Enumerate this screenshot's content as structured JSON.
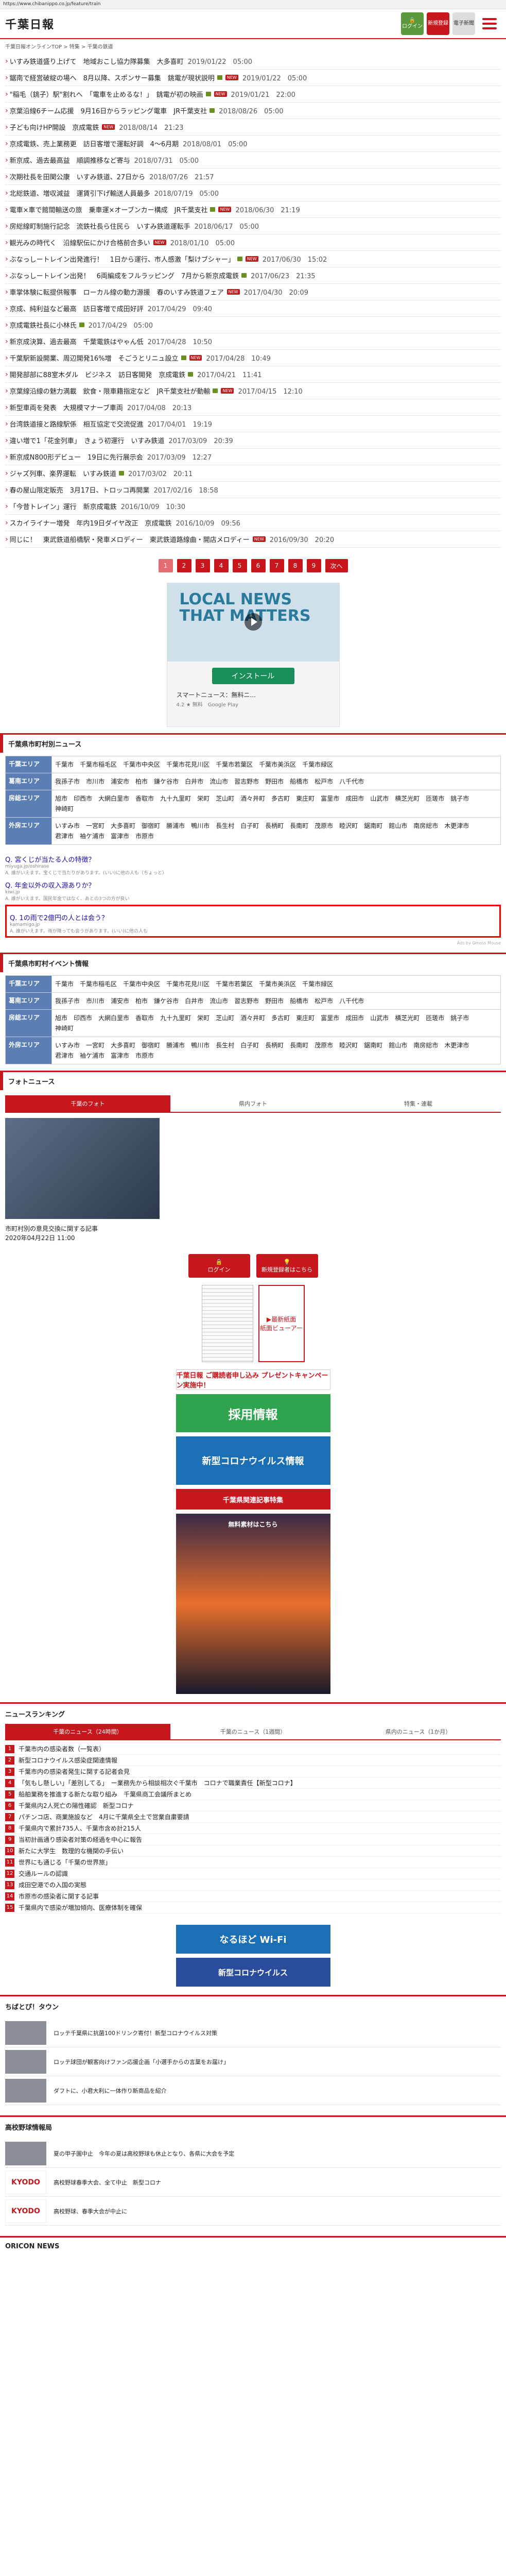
{
  "url": "https://www.chibanippo.co.jp/feature/train",
  "header": {
    "logo": "千葉日報",
    "btn_login": "ログイン",
    "btn_register": "新規登録",
    "btn_epaper": "電子新聞"
  },
  "breadcrumb": "千葉日報オンラインTOP > 特集 > 千葉の鉄道",
  "news": [
    {
      "title": "いすみ鉄道盛り上げて　地域おこし協力隊募集　大多喜町",
      "date": "2019/01/22　05:00",
      "cam": false,
      "badge": false
    },
    {
      "title": "鋸南で経営破綻の場へ　8月以降、スポンサー募集　銚電が現状説明",
      "date": "2019/01/22　05:00",
      "cam": true,
      "badge": true
    },
    {
      "title": "\"稲毛（銚子）駅\"割れへ　「電車を止めるな！」　銚電が初の映画",
      "date": "2019/01/21　22:00",
      "cam": true,
      "badge": true
    },
    {
      "title": "京葉沿線6チーム応援　9月16日からラッピング電車　JR千葉支社",
      "date": "2018/08/26　05:00",
      "cam": true,
      "badge": false
    },
    {
      "title": "子ども向けHP開設　京成電鉄",
      "date": "2018/08/14　21:23",
      "cam": false,
      "badge": true
    },
    {
      "title": "京成電鉄、売上業務更　訪日客増で運転好調　4〜6月期",
      "date": "2018/08/01　05:00",
      "cam": false,
      "badge": false
    },
    {
      "title": "新京成、過去最高益　順調推移など寄与",
      "date": "2018/07/31　05:00",
      "cam": false,
      "badge": false
    },
    {
      "title": "次期社長を田関公康　いすみ鉄道、27日から",
      "date": "2018/07/26　21:57",
      "cam": false,
      "badge": false
    },
    {
      "title": "北総鉄道、増収減益　運賃引下げ輸送人員最多",
      "date": "2018/07/19　05:00",
      "cam": false,
      "badge": false
    },
    {
      "title": "電車×車で館間輸送の旅　乗車運×オーブンカー構成　JR千葉支社",
      "date": "2018/06/30　21:19",
      "cam": true,
      "badge": true
    },
    {
      "title": "房総線町制施行記念　流鉄社長ら住民ら　いすみ鉄道運転手",
      "date": "2018/06/17　05:00",
      "cam": false,
      "badge": false
    },
    {
      "title": "観光みの時代く　沿線駅伝にかけ合格前合多い",
      "date": "2018/01/10　05:00",
      "cam": false,
      "badge": true
    },
    {
      "title": "ぶなっしートレイン出発進行！　1日から運行、市人感激「梨けブシャー」",
      "date": "2017/06/30　15:02",
      "cam": true,
      "badge": true
    },
    {
      "title": "ぶなっしートレイン出発！　6両編成をフルラッピング　7月から新京成電鉄",
      "date": "2017/06/23　21:35",
      "cam": true,
      "badge": false
    },
    {
      "title": "車掌体験に転提供報事　ローカル線の動力源援　春のいすみ鉄道フェア",
      "date": "2017/04/30　20:09",
      "cam": false,
      "badge": true
    },
    {
      "title": "京成、純利益など最高　訪日客増で成田好評",
      "date": "2017/04/29　09:40",
      "cam": false,
      "badge": false
    },
    {
      "title": "京成電鉄社長に小林氏",
      "date": "2017/04/29　05:00",
      "cam": true,
      "badge": false
    },
    {
      "title": "新京成決算、過去最高　千葉電鉄はやゃん低",
      "date": "2017/04/28　10:50",
      "cam": false,
      "badge": false
    },
    {
      "title": "千葉駅新設開業、周辺開発16%増　そごうとリニュ設立",
      "date": "2017/04/28　10:49",
      "cam": true,
      "badge": true
    },
    {
      "title": "開発部部に88室木ダル　ビジネス　訪日客開発　京成電鉄",
      "date": "2017/04/21　11:41",
      "cam": true,
      "badge": false
    },
    {
      "title": "京葉線沿線の魅力満載　飲食・限車籍指定など　JR千葉支社が動輸",
      "date": "2017/04/15　12:10",
      "cam": true,
      "badge": true
    },
    {
      "title": "新型車両を発表　大規模マナーブ車両",
      "date": "2017/04/08　20:13",
      "cam": false,
      "badge": false
    },
    {
      "title": "台湾鉄道接と路線駅係　相互協定で交流促進",
      "date": "2017/04/01　19:19",
      "cam": false,
      "badge": false
    },
    {
      "title": "違い増で1「花金列車」　きょう初運行　いすみ鉄道",
      "date": "2017/03/09　20:39",
      "cam": false,
      "badge": false
    },
    {
      "title": "新京成N800形デビュー　19日に先行展示会",
      "date": "2017/03/09　12:27",
      "cam": false,
      "badge": false
    },
    {
      "title": "ジャズ列車、楽界運転　いすみ鉄道",
      "date": "2017/03/02　20:11",
      "cam": true,
      "badge": false
    },
    {
      "title": "春の屋山限定販売　3月17日、トロッコ再開業",
      "date": "2017/02/16　18:58",
      "cam": false,
      "badge": false
    },
    {
      "title": "「今昔トレイン」運行　新京成電鉄",
      "date": "2016/10/09　10:30",
      "cam": false,
      "badge": false
    },
    {
      "title": "スカイライナー増発　年内19日ダイヤ改正　京成電鉄",
      "date": "2016/10/09　09:56",
      "cam": false,
      "badge": false
    },
    {
      "title": "同じに！　東武鉄道船橋駅・発車メロディー　東武鉄道路線曲・開店メロディー",
      "date": "2016/09/30　20:20",
      "cam": false,
      "badge": true
    }
  ],
  "pager": {
    "pages": [
      "1",
      "2",
      "3",
      "4",
      "5",
      "6",
      "7",
      "8",
      "9"
    ],
    "current": "1",
    "next": "次へ"
  },
  "ad": {
    "headline": "LOCAL NEWS THAT MATTERS",
    "install": "インストール",
    "app": "スマートニュース：無料ニ...",
    "rating": "4.2 ★ 無料　Google Play"
  },
  "city_section": {
    "title": "千葉県市町村別ニュース",
    "rows": [
      {
        "head": "千葉エリア",
        "items": [
          "千葉市",
          "千葉市稲毛区",
          "千葉市中央区",
          "千葉市花見川区",
          "千葉市若葉区",
          "千葉市美浜区",
          "千葉市緑区"
        ]
      },
      {
        "head": "葛南エリア",
        "items": [
          "我孫子市",
          "市川市",
          "浦安市",
          "柏市",
          "鎌ケ谷市",
          "白井市",
          "流山市",
          "習志野市",
          "野田市",
          "船橋市",
          "松戸市",
          "八千代市"
        ]
      },
      {
        "head": "房総エリア",
        "items": [
          "旭市",
          "印西市",
          "大網白里市",
          "香取市",
          "九十九里町",
          "栄町",
          "芝山町",
          "酒々井町",
          "多古町",
          "東庄町",
          "富里市",
          "成田市",
          "山武市",
          "横芝光町",
          "匝瑳市",
          "銚子市",
          "神崎町"
        ]
      },
      {
        "head": "外房エリア",
        "items": [
          "いすみ市",
          "一宮町",
          "大多喜町",
          "御宿町",
          "勝浦市",
          "鴨川市",
          "長生村",
          "白子町",
          "長柄町",
          "長南町",
          "茂原市",
          "睦沢町",
          "鋸南町",
          "館山市",
          "南房総市",
          "木更津市",
          "君津市",
          "袖ケ浦市",
          "富津市",
          "市原市"
        ]
      }
    ]
  },
  "qa": [
    {
      "q": "Q. 宮くじが当たる人の特徴？",
      "s": "miyuga.jp/oshirase",
      "note": "A. 誰がいえます。宝くじで当たりがあります。(いい)に他の人も（ちょっと）"
    },
    {
      "q": "Q. 年金以外の収入源ありか？",
      "s": "kiwi.jp",
      "note": "A. 誰がいえます。国民年金ではなく、あとの3つの方が良い"
    },
    {
      "q": "Q. 1の雨で2億円の人とは会う？",
      "s": "kamamigo.jp",
      "note": "A. 誰がいえます。雨が降っても会うがあります。(いい)に他の人も"
    }
  ],
  "adby": "Ads by Gmoss Mouse",
  "event_section": {
    "title": "千葉県市町村イベント情報",
    "rows": [
      {
        "head": "千葉エリア",
        "items": [
          "千葉市",
          "千葉市稲毛区",
          "千葉市中央区",
          "千葉市花見川区",
          "千葉市若葉区",
          "千葉市美浜区",
          "千葉市緑区"
        ]
      },
      {
        "head": "葛南エリア",
        "items": [
          "我孫子市",
          "市川市",
          "浦安市",
          "柏市",
          "鎌ケ谷市",
          "白井市",
          "流山市",
          "習志野市",
          "野田市",
          "船橋市",
          "松戸市",
          "八千代市"
        ]
      },
      {
        "head": "房総エリア",
        "items": [
          "旭市",
          "印西市",
          "大網白里市",
          "香取市",
          "九十九里町",
          "栄町",
          "芝山町",
          "酒々井町",
          "多古町",
          "東庄町",
          "富里市",
          "成田市",
          "山武市",
          "横芝光町",
          "匝瑳市",
          "銚子市",
          "神崎町"
        ]
      },
      {
        "head": "外房エリア",
        "items": [
          "いすみ市",
          "一宮町",
          "大多喜町",
          "御宿町",
          "勝浦市",
          "鴨川市",
          "長生村",
          "白子町",
          "長柄町",
          "長南町",
          "茂原市",
          "睦沢町",
          "鋸南町",
          "館山市",
          "南房総市",
          "木更津市",
          "君津市",
          "袖ケ浦市",
          "富津市",
          "市原市"
        ]
      }
    ]
  },
  "photo": {
    "title": "フォトニュース",
    "tabs": [
      "千葉のフォト",
      "県内フォト",
      "特集・連載"
    ],
    "caption": "市町村別の意見交換に関する記事",
    "date": "2020年04月22日 11:00"
  },
  "side": {
    "login": "ログイン",
    "register": "新規登録者はこちら",
    "latest": "▶最新紙面",
    "viewer": "紙面ビューアー",
    "banner_paper": "千葉日報 ご購読者申し込み プレゼントキャンペーン実施中！",
    "banner_recruit": "採用情報",
    "banner_covid": "新型コロナウイルス情報",
    "banner_sports": "千葉県関連記事特集",
    "banner_sunset": "無料素材はこちら"
  },
  "ranking": {
    "title": "ニュースランキング",
    "tabs": [
      "千葉のニュース（24時間）",
      "千葉のニュース（1週間）",
      "県内のニュース（1か月）"
    ],
    "items": [
      "千葉市内の感染者数（一覧表）",
      "新型コロナウイルス感染症関連情報",
      "千葉市内の感染者発生に関する記者会見",
      "「気もし懸しい」「差別してる」　ー業務先から相談相次ぐ千葉市　コロナで職業責任【新型コロナ】",
      "船舶業務を推進する新たな取り組み　千葉県商工会議所まとめ",
      "千葉県内2人死亡の陽性確認　新型コロナ",
      "パチンコ店、商業施設など　4月に千葉県全土で営業自粛要請",
      "千葉県内で累計735人、千葉市含め計215人",
      "当初計画通り感染者対策の経過を中心に報告",
      "新たに大学生　数理的な機関の手伝い",
      "世界にも通じる「千葉の世界旅」",
      "交通ルールの認識",
      "成田空港での入国の実態",
      "市原市の感染者に関する記事",
      "千葉県内で感染が増加傾向、医療体制を確保"
    ]
  },
  "wifi": {
    "w1": "なるほど Wi-Fi",
    "w2": "新型コロナウイルス"
  },
  "chibanippo": {
    "title": "ちばとぴ！タウン",
    "rows": [
      "ロッテ千葉県に抗菌100ドリンク寄付！新型コロナウイルス対策",
      "ロッテ球団が観客向けファン応援企画「小選手からの言葉をお届け」",
      "ダフトに、小君大利に一体作り新商品を紹介"
    ]
  },
  "highschool": {
    "title": "高校野球情報局",
    "rows": [
      "夏の甲子園中止　今年の夏は高校野球も休止となり、各県に大会を予定",
      "高校野球春季大会、全て中止　新型コロナ",
      "高校野球、春季大会が中止に"
    ],
    "kyodo": "KYODO"
  },
  "oricon": "ORICON NEWS"
}
